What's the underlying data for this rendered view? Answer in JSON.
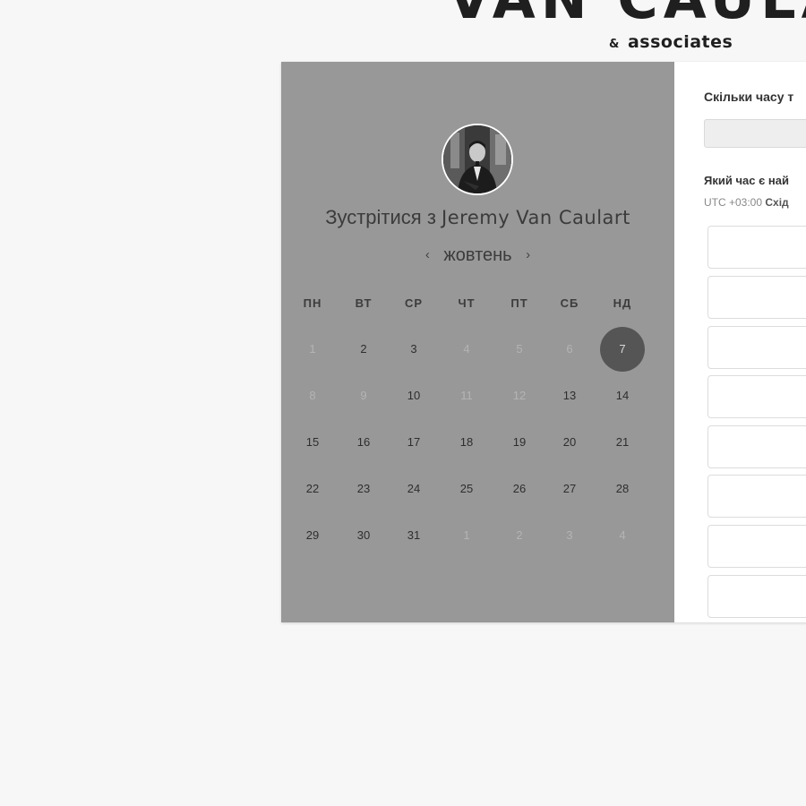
{
  "brand": {
    "name": "VAN CAULA",
    "amp": "&",
    "sub": "associates"
  },
  "host": {
    "meet_prefix": "Зустрітися з ",
    "name": "Jeremy Van Caulart",
    "avatar_icon": "person-photo-icon"
  },
  "calendar": {
    "month": "жовтень",
    "prev_icon": "chevron-left-icon",
    "next_icon": "chevron-right-icon",
    "weekdays": [
      "ПН",
      "ВТ",
      "СР",
      "ЧТ",
      "ПТ",
      "СБ",
      "НД"
    ],
    "weeks": [
      [
        "1",
        "2",
        "3",
        "4",
        "5",
        "6",
        "7"
      ],
      [
        "8",
        "9",
        "10",
        "11",
        "12",
        "13",
        "14"
      ],
      [
        "15",
        "16",
        "17",
        "18",
        "19",
        "20",
        "21"
      ],
      [
        "22",
        "23",
        "24",
        "25",
        "26",
        "27",
        "28"
      ],
      [
        "29",
        "30",
        "31",
        "1",
        "2",
        "3",
        "4"
      ]
    ],
    "selected_day": "7",
    "colors": {
      "panel_bg": "#989898",
      "selected_bg": "#555555",
      "muted_text": "#b4b4b4"
    }
  },
  "booking": {
    "duration_question": "Скільки часу т",
    "time_question": "Який час є най",
    "timezone_prefix": "UTC +03:00 ",
    "timezone_name": "Схід"
  }
}
